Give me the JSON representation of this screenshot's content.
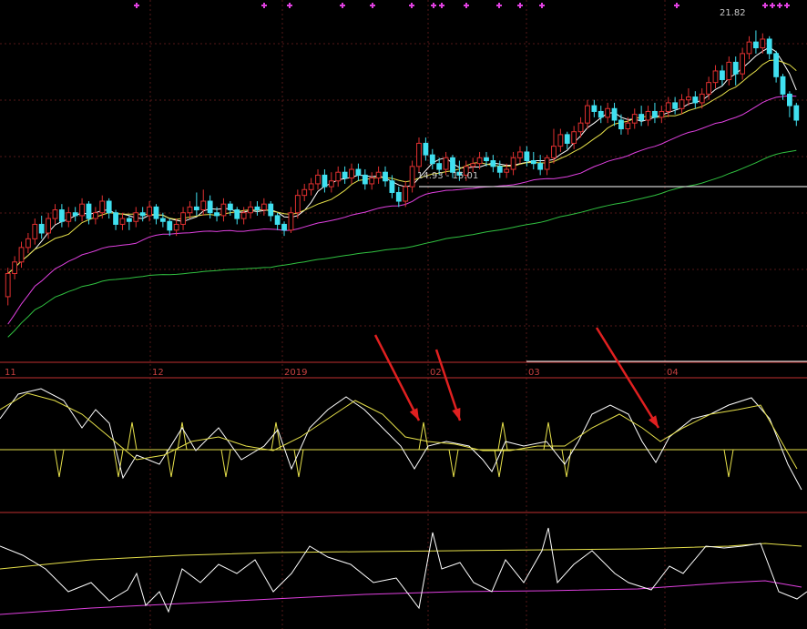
{
  "chart_data": {
    "type": "candlestick",
    "main": {
      "ylim": [
        12.0,
        22.6
      ],
      "high_label": "21.82",
      "range_label": "14.93 - 15.01",
      "candles": [
        [
          12.6,
          13.4,
          12.3,
          13.6
        ],
        [
          13.4,
          13.8,
          13.2,
          14.0
        ],
        [
          13.8,
          14.3,
          13.6,
          14.5
        ],
        [
          14.3,
          14.6,
          14.1,
          14.8
        ],
        [
          14.6,
          15.1,
          14.4,
          15.3
        ],
        [
          15.1,
          14.8,
          14.6,
          15.4
        ],
        [
          14.8,
          15.3,
          14.6,
          15.5
        ],
        [
          15.3,
          15.6,
          15.1,
          15.8
        ],
        [
          15.6,
          15.2,
          15.0,
          15.8
        ],
        [
          15.2,
          15.5,
          15.0,
          15.7
        ],
        [
          15.5,
          15.4,
          15.2,
          15.7
        ],
        [
          15.4,
          15.8,
          15.2,
          16.0
        ],
        [
          15.8,
          15.3,
          15.1,
          15.9
        ],
        [
          15.3,
          15.5,
          15.1,
          15.7
        ],
        [
          15.5,
          15.9,
          15.3,
          16.1
        ],
        [
          15.9,
          15.5,
          15.3,
          16.0
        ],
        [
          15.5,
          15.1,
          14.9,
          15.6
        ],
        [
          15.1,
          15.3,
          14.9,
          15.5
        ],
        [
          15.3,
          15.2,
          14.9,
          15.4
        ],
        [
          15.2,
          15.5,
          15.0,
          15.7
        ],
        [
          15.5,
          15.4,
          15.2,
          15.7
        ],
        [
          15.4,
          15.7,
          15.2,
          15.9
        ],
        [
          15.7,
          15.3,
          15.1,
          15.8
        ],
        [
          15.3,
          15.2,
          15.0,
          15.5
        ],
        [
          15.2,
          14.9,
          14.7,
          15.3
        ],
        [
          14.9,
          15.1,
          14.7,
          15.3
        ],
        [
          15.1,
          15.5,
          14.9,
          15.7
        ],
        [
          15.5,
          15.7,
          15.3,
          15.9
        ],
        [
          15.7,
          15.6,
          15.4,
          16.2
        ],
        [
          15.6,
          15.9,
          15.4,
          16.3
        ],
        [
          15.9,
          15.5,
          15.3,
          16.1
        ],
        [
          15.5,
          15.4,
          15.2,
          15.7
        ],
        [
          15.4,
          15.8,
          15.2,
          16.0
        ],
        [
          15.8,
          15.6,
          15.4,
          15.9
        ],
        [
          15.6,
          15.3,
          15.1,
          15.7
        ],
        [
          15.3,
          15.5,
          15.1,
          15.7
        ],
        [
          15.5,
          15.7,
          15.3,
          15.9
        ],
        [
          15.7,
          15.6,
          15.4,
          15.9
        ],
        [
          15.6,
          15.8,
          15.4,
          16.0
        ],
        [
          15.8,
          15.4,
          15.2,
          15.9
        ],
        [
          15.4,
          15.1,
          14.9,
          15.5
        ],
        [
          15.1,
          14.9,
          14.7,
          15.2
        ],
        [
          14.9,
          15.5,
          14.8,
          15.7
        ],
        [
          15.5,
          16.1,
          15.3,
          16.3
        ],
        [
          16.1,
          16.3,
          15.9,
          16.5
        ],
        [
          16.3,
          16.5,
          16.1,
          16.7
        ],
        [
          16.5,
          16.8,
          16.3,
          17.0
        ],
        [
          16.8,
          16.4,
          16.2,
          17.0
        ],
        [
          16.4,
          16.6,
          16.2,
          16.9
        ],
        [
          16.6,
          16.9,
          16.4,
          17.1
        ],
        [
          16.9,
          16.7,
          16.5,
          17.1
        ],
        [
          16.7,
          17.0,
          16.5,
          17.2
        ],
        [
          17.0,
          16.8,
          16.6,
          17.2
        ],
        [
          16.8,
          16.5,
          16.3,
          17.0
        ],
        [
          16.5,
          16.7,
          16.3,
          16.9
        ],
        [
          16.7,
          16.9,
          16.5,
          17.1
        ],
        [
          16.9,
          16.6,
          16.4,
          17.1
        ],
        [
          16.6,
          16.2,
          16.0,
          16.8
        ],
        [
          16.2,
          15.9,
          15.7,
          16.4
        ],
        [
          15.9,
          16.4,
          15.7,
          16.6
        ],
        [
          16.4,
          17.1,
          16.2,
          17.3
        ],
        [
          17.1,
          17.9,
          16.9,
          18.1
        ],
        [
          17.9,
          17.5,
          17.3,
          18.1
        ],
        [
          17.5,
          17.2,
          17.0,
          17.7
        ],
        [
          17.2,
          17.0,
          16.8,
          17.4
        ],
        [
          17.0,
          17.4,
          16.8,
          17.6
        ],
        [
          17.4,
          16.9,
          16.7,
          17.5
        ],
        [
          16.9,
          16.8,
          16.6,
          17.3
        ],
        [
          16.8,
          17.1,
          16.6,
          17.3
        ],
        [
          17.1,
          17.2,
          16.9,
          17.4
        ],
        [
          17.2,
          17.4,
          17.0,
          17.6
        ],
        [
          17.4,
          17.3,
          17.1,
          17.6
        ],
        [
          17.3,
          17.1,
          16.9,
          17.5
        ],
        [
          17.1,
          16.9,
          16.7,
          17.3
        ],
        [
          16.9,
          17.0,
          16.7,
          17.2
        ],
        [
          17.0,
          17.4,
          16.8,
          17.6
        ],
        [
          17.4,
          17.6,
          17.2,
          17.8
        ],
        [
          17.6,
          17.3,
          17.1,
          17.8
        ],
        [
          17.3,
          17.2,
          17.0,
          17.6
        ],
        [
          17.2,
          17.0,
          16.8,
          17.5
        ],
        [
          17.0,
          17.4,
          16.8,
          17.5
        ],
        [
          17.4,
          17.8,
          17.2,
          18.4
        ],
        [
          17.8,
          18.2,
          17.6,
          18.4
        ],
        [
          18.2,
          17.9,
          17.7,
          18.3
        ],
        [
          17.9,
          18.3,
          17.7,
          18.5
        ],
        [
          18.3,
          18.6,
          18.1,
          18.8
        ],
        [
          18.6,
          19.2,
          18.4,
          19.4
        ],
        [
          19.2,
          19.0,
          18.8,
          19.4
        ],
        [
          19.0,
          18.8,
          18.6,
          19.2
        ],
        [
          18.8,
          19.1,
          18.6,
          19.3
        ],
        [
          19.1,
          18.7,
          18.5,
          19.3
        ],
        [
          18.7,
          18.4,
          18.2,
          18.9
        ],
        [
          18.4,
          18.6,
          18.2,
          18.8
        ],
        [
          18.6,
          18.9,
          18.4,
          19.1
        ],
        [
          18.9,
          18.7,
          18.5,
          19.2
        ],
        [
          18.7,
          19.0,
          18.5,
          19.2
        ],
        [
          19.0,
          18.8,
          18.6,
          19.3
        ],
        [
          18.8,
          19.0,
          18.6,
          19.2
        ],
        [
          19.0,
          19.3,
          18.8,
          19.5
        ],
        [
          19.3,
          19.1,
          18.9,
          19.5
        ],
        [
          19.1,
          19.4,
          18.9,
          19.6
        ],
        [
          19.4,
          19.5,
          19.2,
          19.8
        ],
        [
          19.5,
          19.3,
          19.1,
          19.7
        ],
        [
          19.3,
          19.6,
          19.1,
          19.8
        ],
        [
          19.6,
          20.0,
          19.4,
          20.2
        ],
        [
          20.0,
          20.4,
          19.8,
          20.6
        ],
        [
          20.4,
          20.1,
          19.9,
          20.6
        ],
        [
          20.1,
          20.7,
          19.9,
          20.9
        ],
        [
          20.7,
          20.3,
          19.9,
          20.9
        ],
        [
          20.3,
          21.0,
          20.1,
          21.2
        ],
        [
          21.0,
          21.4,
          20.8,
          21.6
        ],
        [
          21.4,
          21.2,
          21.0,
          21.8
        ],
        [
          21.2,
          21.5,
          21.0,
          21.7
        ],
        [
          21.5,
          21.0,
          20.8,
          21.6
        ],
        [
          21.0,
          20.2,
          20.0,
          21.1
        ],
        [
          20.2,
          19.6,
          19.4,
          20.3
        ],
        [
          19.6,
          19.2,
          18.8,
          19.7
        ],
        [
          19.2,
          18.7,
          18.5,
          19.3
        ]
      ]
    },
    "x_tick_labels": [
      "11",
      "12",
      "2019",
      "02",
      "03",
      "04"
    ],
    "colors": {
      "up": "#e03030",
      "down": "#40e0f0",
      "ma_short": "#ffffff",
      "ma_mid": "#e6e04a",
      "ma_60": "#e040e0",
      "ma_120": "#30c040",
      "axis": "#c03030",
      "indicator": "#e6e04a"
    },
    "signal_markers": 15,
    "annotations": [
      "arrow",
      "arrow",
      "arrow"
    ]
  }
}
